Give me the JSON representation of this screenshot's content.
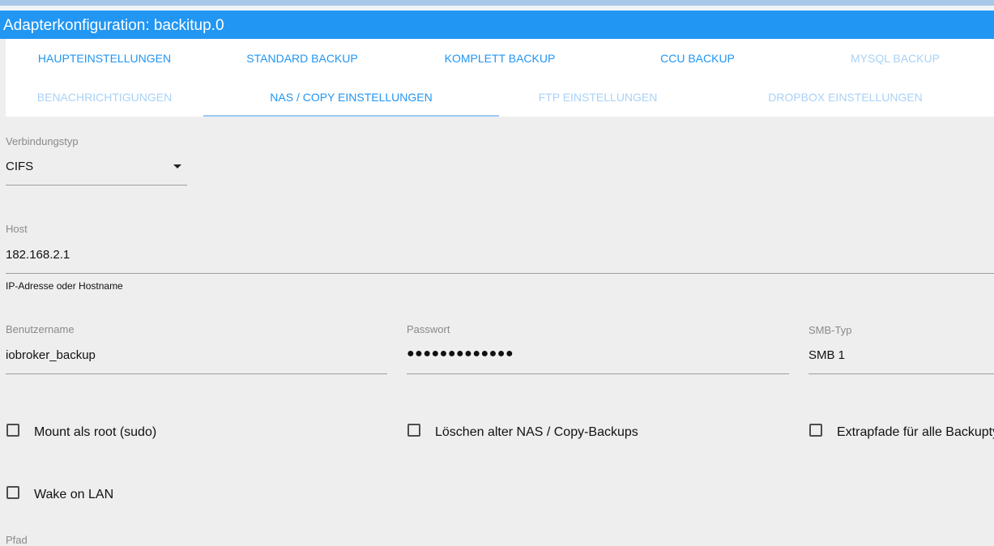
{
  "window": {
    "title": "Adapterkonfiguration: backitup.0"
  },
  "colors": {
    "accent": "#2196f3",
    "tab_inactive": "#a9d2f8",
    "background": "#eeeeee"
  },
  "tabs": [
    {
      "label": "HAUPTEINSTELLUNGEN",
      "state": "enabled"
    },
    {
      "label": "STANDARD BACKUP",
      "state": "enabled"
    },
    {
      "label": "KOMPLETT BACKUP",
      "state": "enabled"
    },
    {
      "label": "CCU BACKUP",
      "state": "enabled"
    },
    {
      "label": "MYSQL BACKUP",
      "state": "disabled"
    },
    {
      "label": "BENACHRICHTIGUNGEN",
      "state": "disabled"
    },
    {
      "label": "NAS / COPY EINSTELLUNGEN",
      "state": "active"
    },
    {
      "label": "FTP EINSTELLUNGEN",
      "state": "disabled"
    },
    {
      "label": "DROPBOX EINSTELLUNGEN",
      "state": "disabled"
    }
  ],
  "form": {
    "connection_type": {
      "label": "Verbindungstyp",
      "value": "CIFS",
      "icon": "dropdown-arrow-icon"
    },
    "host": {
      "label": "Host",
      "value": "182.168.2.1",
      "helper": "IP-Adresse oder Hostname"
    },
    "username": {
      "label": "Benutzername",
      "value": "iobroker_backup"
    },
    "password": {
      "label": "Passwort",
      "value": "●●●●●●●●●●●●●"
    },
    "smb_type": {
      "label": "SMB-Typ",
      "value": "SMB 1"
    },
    "checkboxes": [
      {
        "label": "Mount als root (sudo)",
        "checked": false
      },
      {
        "label": "Löschen alter NAS / Copy-Backups",
        "checked": false
      },
      {
        "label": "Extrapfade für alle Backupty",
        "checked": false
      },
      {
        "label": "Wake on LAN",
        "checked": false
      }
    ],
    "cut_label": "Pfad"
  }
}
